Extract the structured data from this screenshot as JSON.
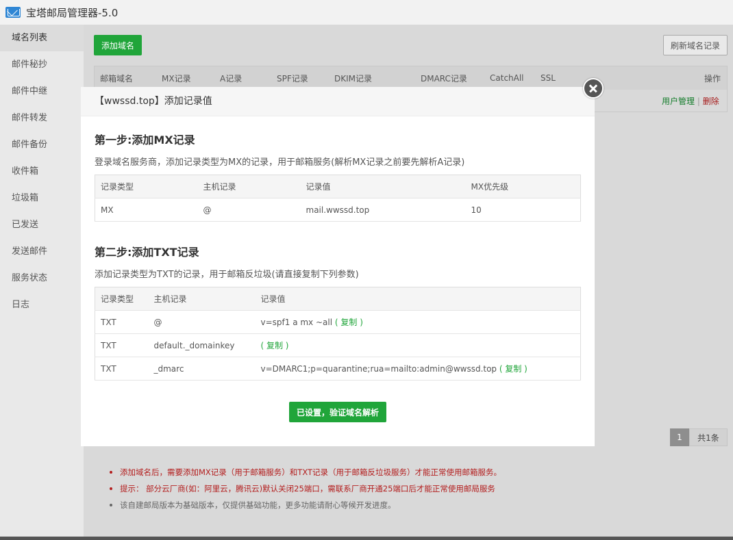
{
  "window": {
    "title": "宝塔邮局管理器-5.0",
    "icon": "mail-icon"
  },
  "sidebar": {
    "items": [
      {
        "label": "域名列表",
        "active": true
      },
      {
        "label": "邮件秘抄"
      },
      {
        "label": "邮件中继"
      },
      {
        "label": "邮件转发"
      },
      {
        "label": "邮件备份"
      },
      {
        "label": "收件箱"
      },
      {
        "label": "垃圾箱"
      },
      {
        "label": "已发送"
      },
      {
        "label": "发送邮件"
      },
      {
        "label": "服务状态"
      },
      {
        "label": "日志"
      }
    ]
  },
  "toolbar": {
    "add_label": "添加域名",
    "refresh_label": "刷新域名记录"
  },
  "domain_table": {
    "columns": [
      "邮箱域名",
      "MX记录",
      "A记录",
      "SPF记录",
      "DKIM记录",
      "DMARC记录",
      "CatchAll",
      "SSL",
      "操作"
    ],
    "row": {
      "user_manage": "用户管理",
      "separator": "|",
      "delete": "删除"
    }
  },
  "pager": {
    "page": "1",
    "total": "共1条"
  },
  "notes": [
    "添加域名后，需要添加MX记录（用于邮箱服务）和TXT记录（用于邮箱反垃圾服务）才能正常使用邮箱服务。",
    "提示： 部分云厂商(如：阿里云，腾讯云)默认关闭25端口，需联系厂商开通25端口后才能正常使用邮局服务",
    "该自建邮局版本为基础版本，仅提供基础功能，更多功能请耐心等候开发进度。"
  ],
  "modal": {
    "title": "【wwssd.top】添加记录值",
    "step1": {
      "title": "第一步:添加MX记录",
      "desc": "登录域名服务商，添加记录类型为MX的记录，用于邮箱服务(解析MX记录之前要先解析A记录)",
      "columns": [
        "记录类型",
        "主机记录",
        "记录值",
        "MX优先级"
      ],
      "rows": [
        {
          "type": "MX",
          "host": "@",
          "value": "mail.wwssd.top",
          "priority": "10"
        }
      ]
    },
    "step2": {
      "title": "第二步:添加TXT记录",
      "desc": "添加记录类型为TXT的记录，用于邮箱反垃圾(请直接复制下列参数)",
      "columns": [
        "记录类型",
        "主机记录",
        "记录值"
      ],
      "rows": [
        {
          "type": "TXT",
          "host": "@",
          "value": "v=spf1 a mx ~all",
          "copy": "( 复制 )"
        },
        {
          "type": "TXT",
          "host": "default._domainkey",
          "value": "",
          "copy": "( 复制 )"
        },
        {
          "type": "TXT",
          "host": "_dmarc",
          "value": "v=DMARC1;p=quarantine;rua=mailto:admin@wwssd.top",
          "copy": "( 复制 )"
        }
      ]
    },
    "verify_label": "已设置，验证域名解析"
  },
  "colors": {
    "accent_green": "#20a53a",
    "danger_red": "#b31d1d"
  }
}
